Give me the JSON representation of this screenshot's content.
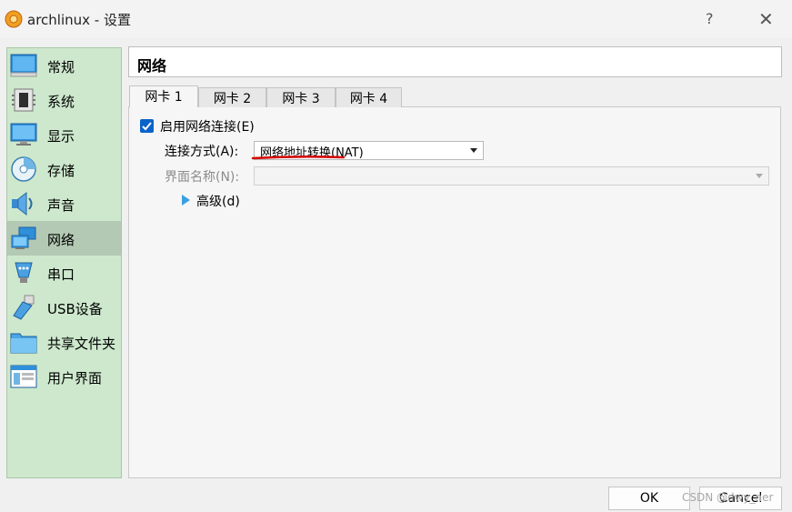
{
  "window": {
    "title": "archlinux - 设置",
    "help": "?",
    "close": "✕"
  },
  "sidebar": {
    "items": [
      {
        "label": "常规",
        "icon": "general-icon"
      },
      {
        "label": "系统",
        "icon": "system-chip-icon"
      },
      {
        "label": "显示",
        "icon": "monitor-icon"
      },
      {
        "label": "存储",
        "icon": "storage-disc-icon"
      },
      {
        "label": "声音",
        "icon": "speaker-icon"
      },
      {
        "label": "网络",
        "icon": "network-icon",
        "selected": true
      },
      {
        "label": "串口",
        "icon": "serial-port-icon"
      },
      {
        "label": "USB设备",
        "icon": "usb-icon"
      },
      {
        "label": "共享文件夹",
        "icon": "folder-icon"
      },
      {
        "label": "用户界面",
        "icon": "user-interface-icon"
      }
    ]
  },
  "section": {
    "title": "网络"
  },
  "tabs": [
    {
      "label": "网卡 1",
      "active": true
    },
    {
      "label": "网卡 2"
    },
    {
      "label": "网卡 3"
    },
    {
      "label": "网卡 4"
    }
  ],
  "adapter": {
    "enable_label": "启用网络连接(E)",
    "enabled": true,
    "attach_label": "连接方式(A):",
    "attach_value": "网络地址转换(NAT)",
    "name_label": "界面名称(N):",
    "name_value": "",
    "advanced_label": "高级(d)"
  },
  "buttons": {
    "ok": "OK",
    "cancel": "Cancel"
  },
  "watermark": "CSDN @dwy_ner",
  "colors": {
    "sidebar_bg": "#cde8cd",
    "selected_bg": "#b3c9b3",
    "checkbox": "#0a63c9",
    "annotation": "#d40000"
  }
}
